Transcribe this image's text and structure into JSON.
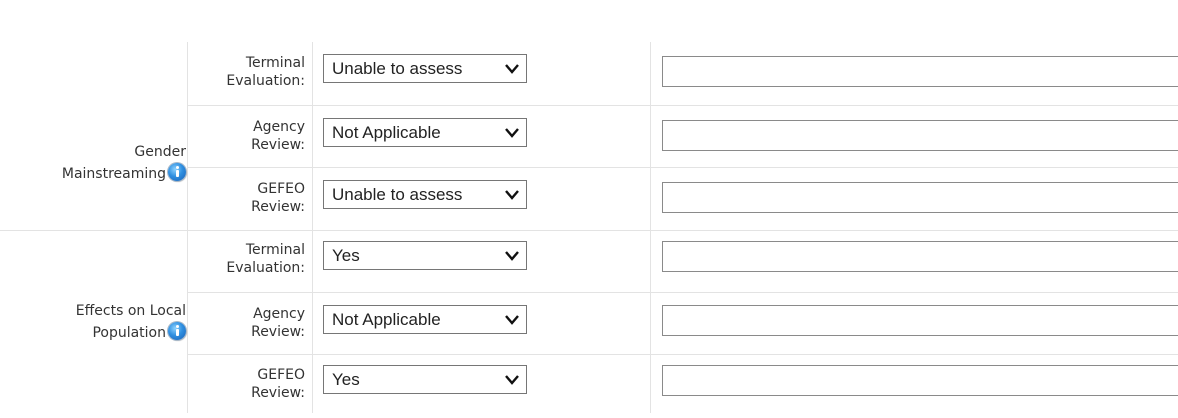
{
  "groups": [
    {
      "label_line1": "Gender",
      "label_line2": "Mainstreaming",
      "rows": [
        {
          "label_line1": "Terminal",
          "label_line2": "Evaluation:",
          "value": "Unable to assess",
          "comment": ""
        },
        {
          "label_line1": "Agency",
          "label_line2": "Review:",
          "value": "Not Applicable",
          "comment": ""
        },
        {
          "label_line1": "GEFEO",
          "label_line2": "Review:",
          "value": "Unable to assess",
          "comment": ""
        }
      ]
    },
    {
      "label_line1": "Effects on Local",
      "label_line2": "Population",
      "rows": [
        {
          "label_line1": "Terminal",
          "label_line2": "Evaluation:",
          "value": "Yes",
          "comment": ""
        },
        {
          "label_line1": "Agency",
          "label_line2": "Review:",
          "value": "Not Applicable",
          "comment": ""
        },
        {
          "label_line1": "GEFEO",
          "label_line2": "Review:",
          "value": "Yes",
          "comment": ""
        }
      ]
    }
  ],
  "icons": {
    "info": "info-icon",
    "dropdown": "chevron-down-icon"
  }
}
